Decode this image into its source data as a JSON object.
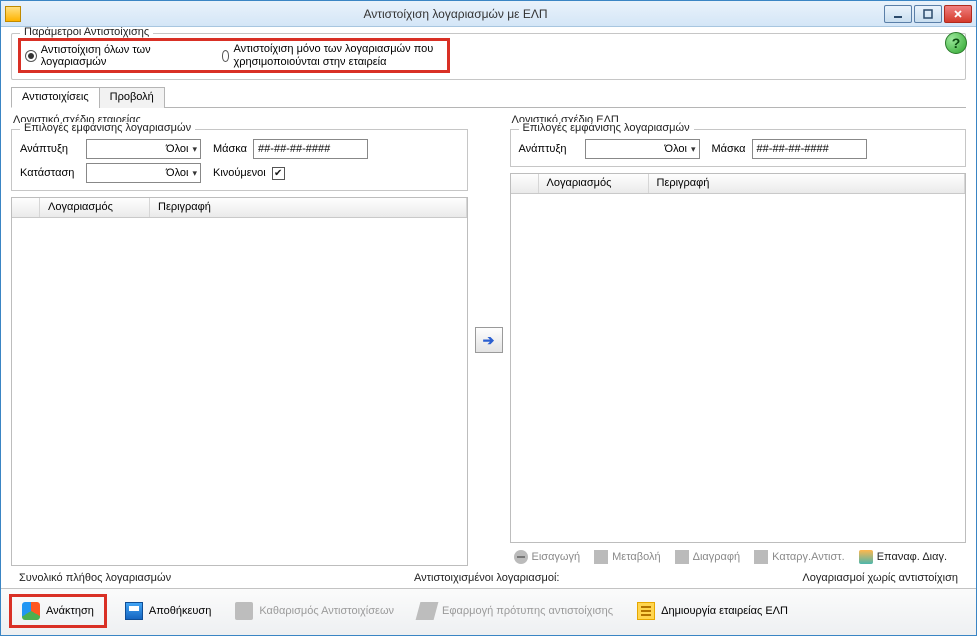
{
  "window": {
    "title": "Αντιστοίχιση λογαριασμών με ΕΛΠ"
  },
  "params": {
    "legend": "Παράμετροι Αντιστοίχισης",
    "radio_all": "Αντιστοίχιση όλων των λογαριασμών",
    "radio_used": "Αντιστοίχιση μόνο των λογαριασμών που χρησιμοποιούνται στην εταιρεία",
    "help": "?"
  },
  "tabs": {
    "matches": "Αντιστοιχίσεις",
    "view": "Προβολή"
  },
  "left": {
    "title": "Λογιστικό σχέδιο εταιρείας",
    "options_legend": "Επιλογές εμφάνισης λογαριασμών",
    "level_label": "Ανάπτυξη",
    "level_value": "Όλοι",
    "mask_label": "Μάσκα",
    "mask_value": "##-##-##-####",
    "status_label": "Κατάσταση",
    "status_value": "Όλοι",
    "moving_label": "Κινούμενοι",
    "col_account": "Λογαριασμός",
    "col_desc": "Περιγραφή"
  },
  "right": {
    "title": "Λογιστικό σχέδιο ΕΛΠ",
    "options_legend": "Επιλογές εμφάνισης λογαριασμών",
    "level_label": "Ανάπτυξη",
    "level_value": "Όλοι",
    "mask_label": "Μάσκα",
    "mask_value": "##-##-##-####",
    "col_account": "Λογαριασμός",
    "col_desc": "Περιγραφή"
  },
  "arrow": "➔",
  "actions": {
    "insert": "Εισαγωγή",
    "edit": "Μεταβολή",
    "delete": "Διαγραφή",
    "cancel_match": "Καταργ.Αντιστ.",
    "restore_del": "Επαναφ. Διαγ."
  },
  "status": {
    "total": "Συνολικό πλήθος λογαριασμών",
    "matched": "Αντιστοιχισμένοι λογαριασμοί:",
    "unmatched": "Λογαριασμοί χωρίς αντιστοίχιση"
  },
  "toolbar": {
    "retrieve": "Ανάκτηση",
    "save": "Αποθήκευση",
    "clear": "Καθαρισμός Αντιστοιχίσεων",
    "apply": "Εφαρμογή πρότυπης αντιστοίχισης",
    "create": "Δημιουργία εταιρείας ΕΛΠ"
  }
}
